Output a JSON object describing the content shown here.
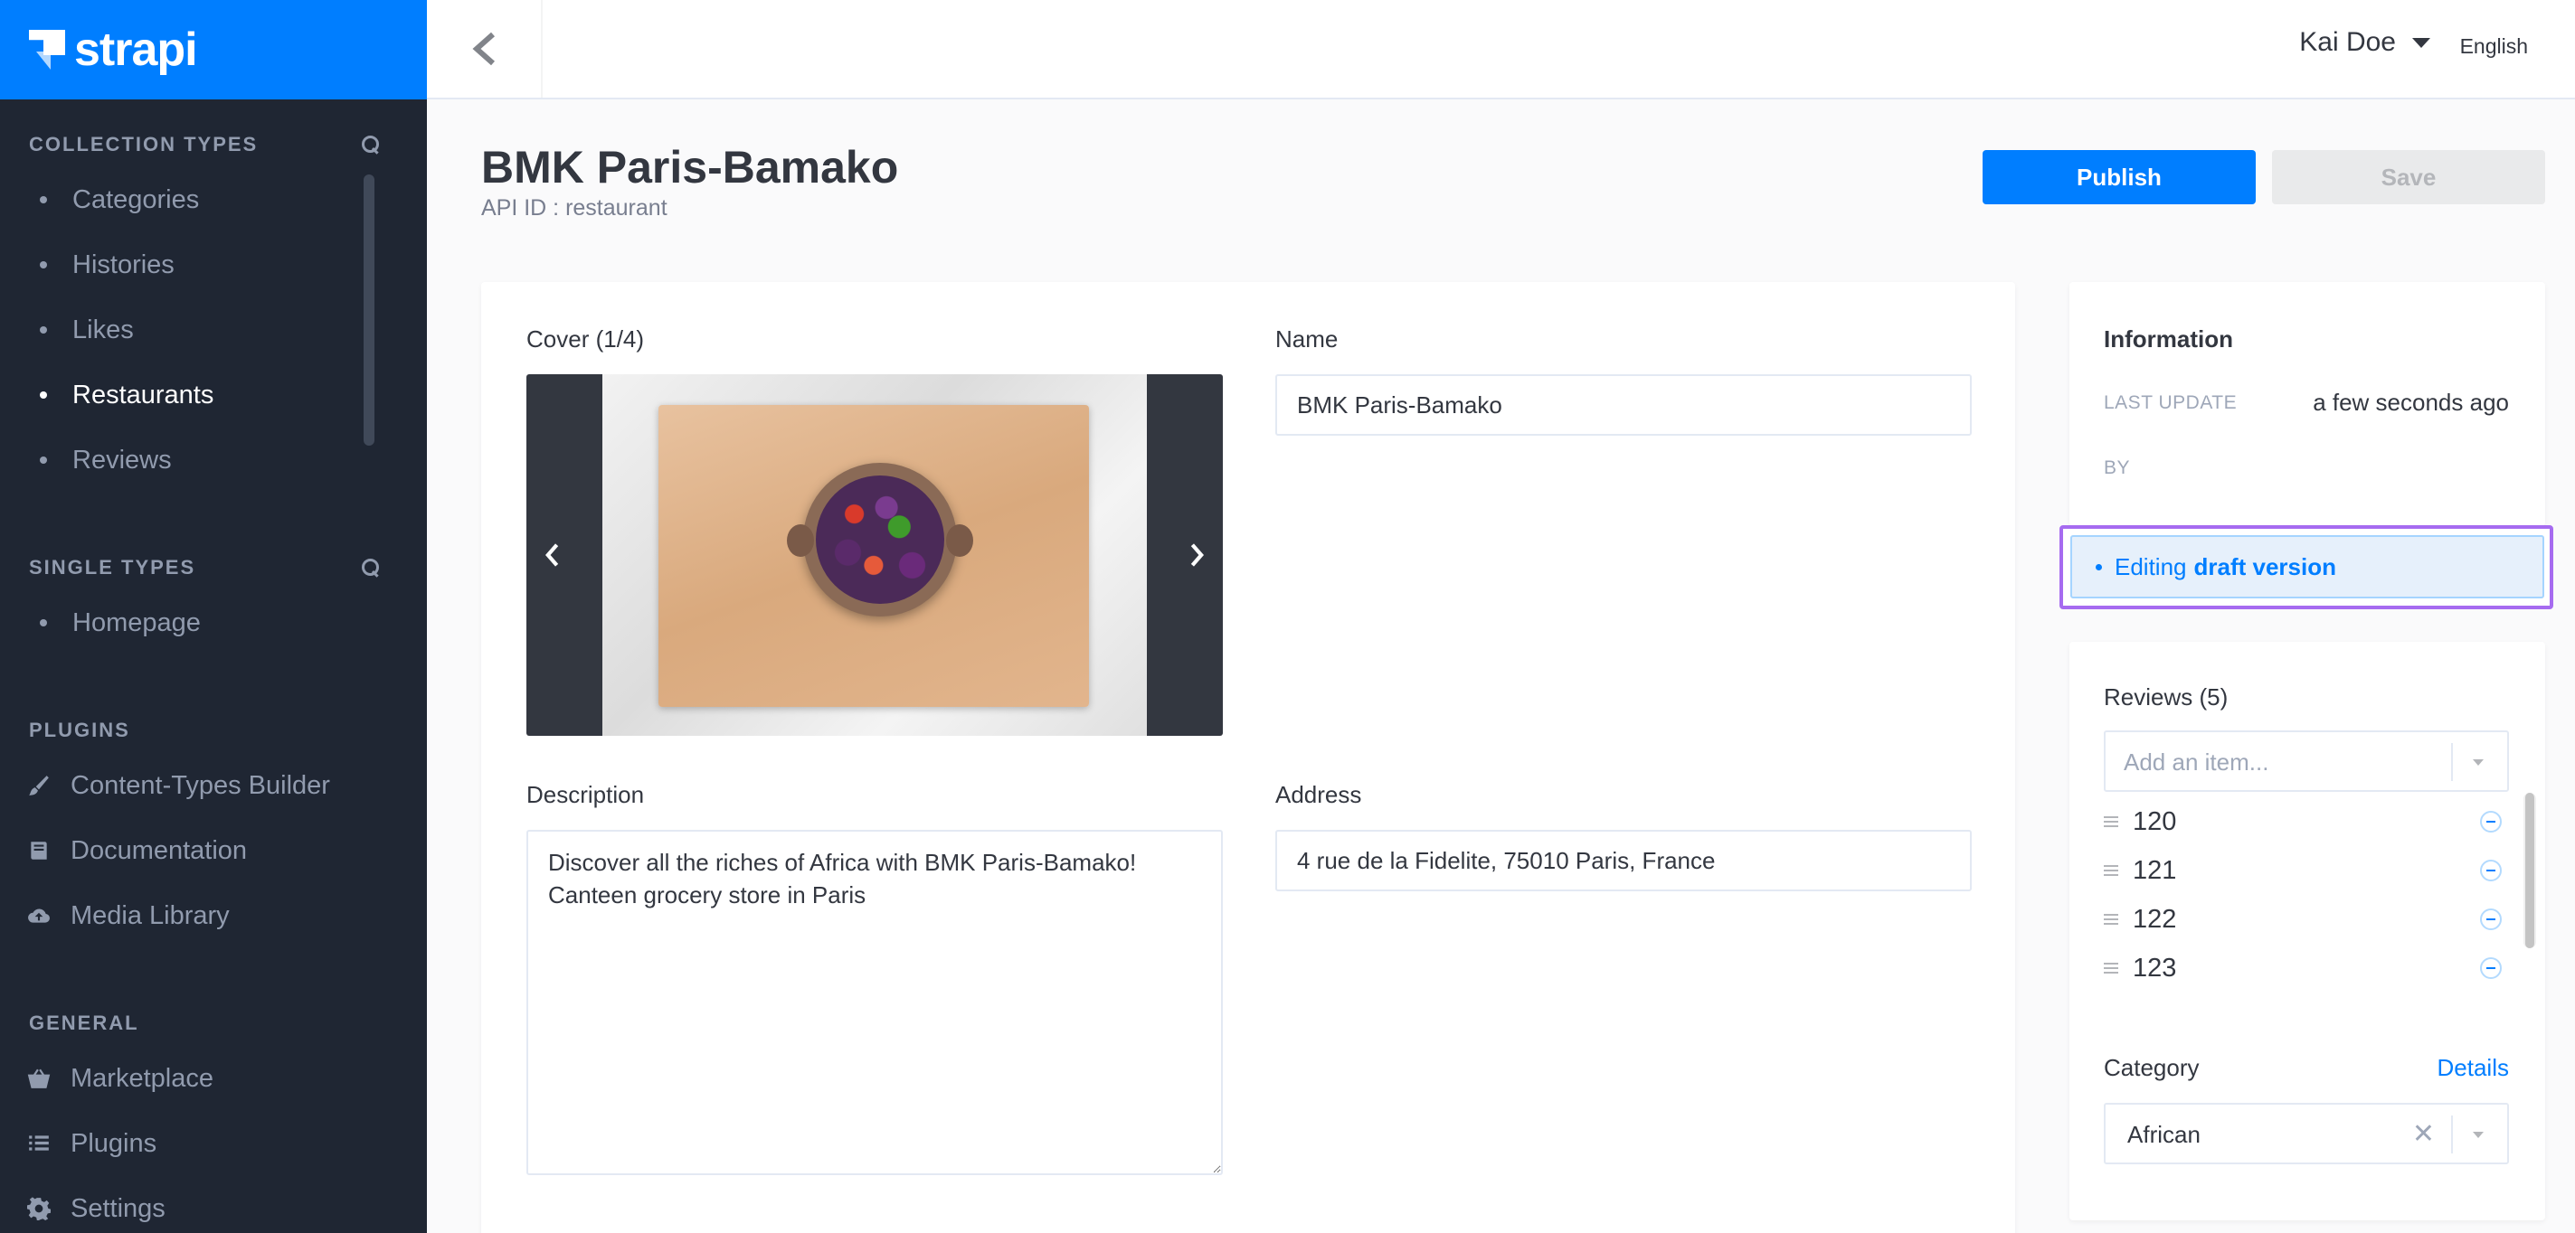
{
  "brand": {
    "name": "strapi"
  },
  "sidebar": {
    "collection_heading": "COLLECTION TYPES",
    "collection_items": [
      {
        "label": "Categories",
        "active": false
      },
      {
        "label": "Histories",
        "active": false
      },
      {
        "label": "Likes",
        "active": false
      },
      {
        "label": "Restaurants",
        "active": true
      },
      {
        "label": "Reviews",
        "active": false
      }
    ],
    "single_heading": "SINGLE TYPES",
    "single_items": [
      {
        "label": "Homepage"
      }
    ],
    "plugins_heading": "PLUGINS",
    "plugin_items": [
      {
        "label": "Content-Types Builder",
        "icon": "paintbrush-icon"
      },
      {
        "label": "Documentation",
        "icon": "book-icon"
      },
      {
        "label": "Media Library",
        "icon": "cloud-upload-icon"
      }
    ],
    "general_heading": "GENERAL",
    "general_items": [
      {
        "label": "Marketplace",
        "icon": "basket-icon"
      },
      {
        "label": "Plugins",
        "icon": "list-icon"
      },
      {
        "label": "Settings",
        "icon": "gear-icon"
      }
    ]
  },
  "header": {
    "user": "Kai Doe",
    "language": "English"
  },
  "page": {
    "title": "BMK Paris-Bamako",
    "subtitle": "API ID : restaurant",
    "publish_label": "Publish",
    "save_label": "Save"
  },
  "form": {
    "cover_label": "Cover (1/4)",
    "name_label": "Name",
    "name_value": "BMK Paris-Bamako",
    "description_label": "Description",
    "description_value": "Discover all the riches of Africa with BMK Paris-Bamako!\nCanteen grocery store in Paris",
    "address_label": "Address",
    "address_value": "4 rue de la Fidelite, 75010 Paris, France"
  },
  "info": {
    "title": "Information",
    "last_update_label": "LAST UPDATE",
    "last_update_value": "a few seconds ago",
    "by_label": "BY",
    "draft_prefix": "Editing",
    "draft_bold": "draft version"
  },
  "relations": {
    "reviews_label": "Reviews (5)",
    "add_placeholder": "Add an item...",
    "reviews": [
      "120",
      "121",
      "122",
      "123"
    ],
    "category_label": "Category",
    "details_link": "Details",
    "category_value": "African"
  },
  "colors": {
    "brand": "#007eff",
    "sidebar_bg": "#1f2633",
    "draft_highlight": "#a66bf0"
  }
}
